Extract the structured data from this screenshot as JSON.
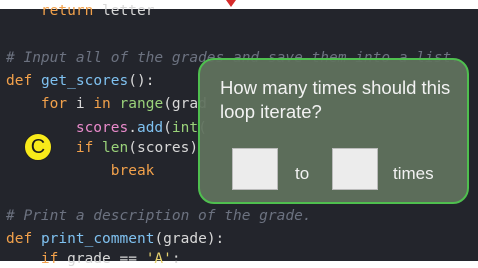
{
  "code": [
    {
      "segments": [
        {
          "t": "    "
        },
        {
          "t": "return",
          "c": "kw"
        },
        {
          "t": " letter"
        }
      ]
    },
    {
      "segments": [
        {
          "t": "# Input all of the grades and save them into a list.",
          "c": "comment"
        }
      ]
    },
    {
      "segments": [
        {
          "t": "def",
          "c": "kw"
        },
        {
          "t": " "
        },
        {
          "t": "get_scores",
          "c": "fn"
        },
        {
          "t": "():"
        }
      ]
    },
    {
      "segments": [
        {
          "t": "    "
        },
        {
          "t": "for",
          "c": "kw"
        },
        {
          "t": " i "
        },
        {
          "t": "in",
          "c": "kw"
        },
        {
          "t": " "
        },
        {
          "t": "range",
          "c": "builtin"
        },
        {
          "t": "(grad"
        }
      ]
    },
    {
      "segments": [
        {
          "t": "        "
        },
        {
          "t": "scores",
          "c": "attr"
        },
        {
          "t": "."
        },
        {
          "t": "add",
          "c": "fn"
        },
        {
          "t": "("
        },
        {
          "t": "int",
          "c": "builtin"
        },
        {
          "t": "("
        }
      ]
    },
    {
      "segments": [
        {
          "t": "        "
        },
        {
          "t": "if",
          "c": "kw"
        },
        {
          "t": " "
        },
        {
          "t": "len",
          "c": "builtin"
        },
        {
          "t": "(scores)"
        }
      ]
    },
    {
      "segments": [
        {
          "t": "            "
        },
        {
          "t": "break",
          "c": "kw"
        }
      ]
    },
    {
      "segments": [
        {
          "t": ""
        }
      ]
    },
    {
      "segments": [
        {
          "t": "# Print a description of the grade.",
          "c": "comment"
        }
      ]
    },
    {
      "segments": [
        {
          "t": "def",
          "c": "kw"
        },
        {
          "t": " "
        },
        {
          "t": "print_comment",
          "c": "fn"
        },
        {
          "t": "(grade):"
        }
      ]
    },
    {
      "segments": [
        {
          "t": "    "
        },
        {
          "t": "if",
          "c": "kw"
        },
        {
          "t": " grade == "
        },
        {
          "t": "'A'",
          "c": "str"
        },
        {
          "t": ":"
        }
      ]
    }
  ],
  "badge": {
    "label": "C"
  },
  "popup": {
    "question": "How many times should this loop iterate?",
    "to_label": "to",
    "times_label": "times",
    "box1_value": "",
    "box2_value": ""
  }
}
